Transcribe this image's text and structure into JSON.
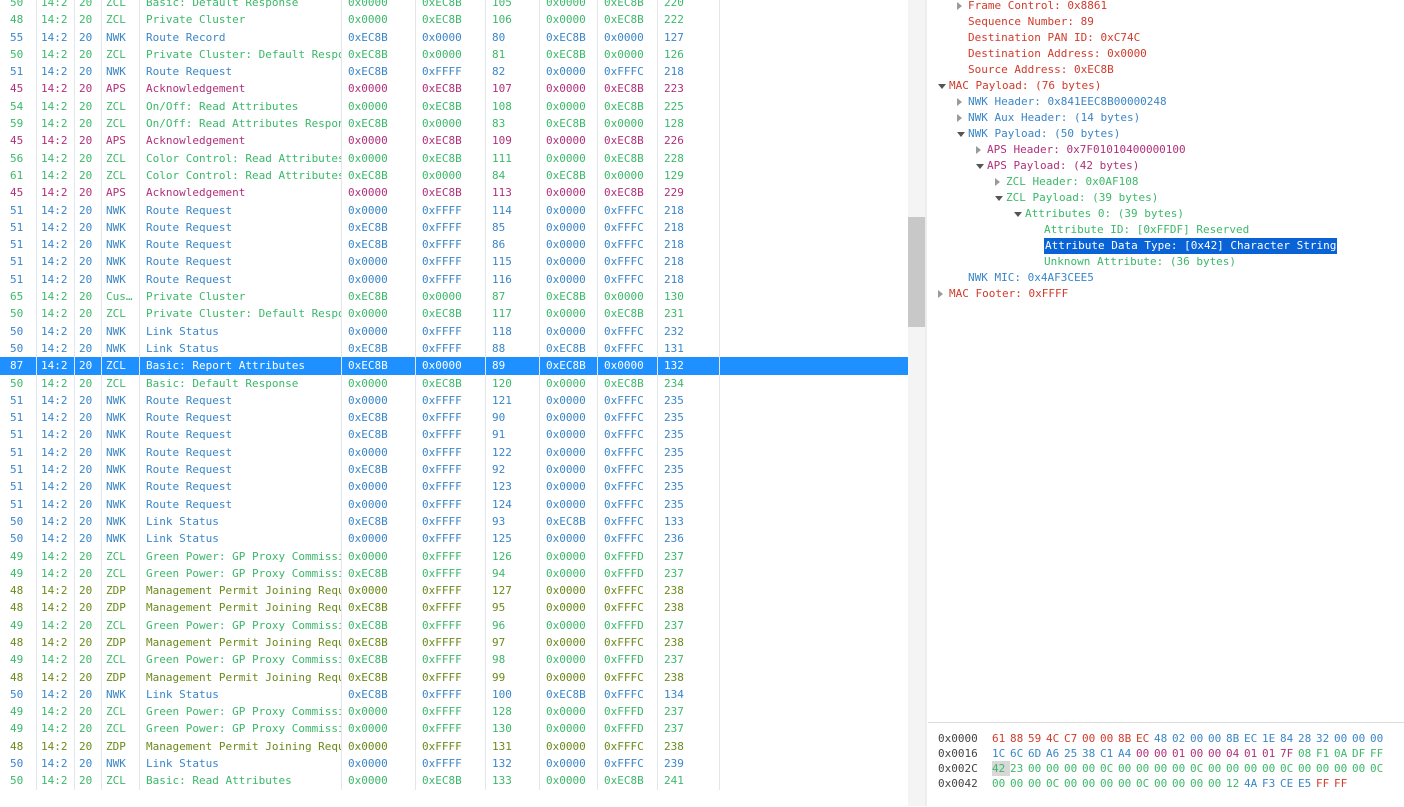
{
  "packet_list": {
    "rows": [
      {
        "len": "50",
        "time": "14:2",
        "ch": "20",
        "type": "ZCL",
        "info": "Basic: Default Response",
        "src": "0x0000",
        "dst": "0xEC8B",
        "seq": "105",
        "s2": "0x0000",
        "d2": "0xEC8B",
        "n": "220"
      },
      {
        "len": "48",
        "time": "14:2",
        "ch": "20",
        "type": "ZCL",
        "info": "Private Cluster",
        "src": "0x0000",
        "dst": "0xEC8B",
        "seq": "106",
        "s2": "0x0000",
        "d2": "0xEC8B",
        "n": "222"
      },
      {
        "len": "55",
        "time": "14:2",
        "ch": "20",
        "type": "NWK",
        "info": "Route Record",
        "src": "0xEC8B",
        "dst": "0x0000",
        "seq": "80",
        "s2": "0xEC8B",
        "d2": "0x0000",
        "n": "127"
      },
      {
        "len": "50",
        "time": "14:2",
        "ch": "20",
        "type": "ZCL",
        "info": "Private Cluster: Default Respo…",
        "src": "0xEC8B",
        "dst": "0x0000",
        "seq": "81",
        "s2": "0xEC8B",
        "d2": "0x0000",
        "n": "126"
      },
      {
        "len": "51",
        "time": "14:2",
        "ch": "20",
        "type": "NWK",
        "info": "Route Request",
        "src": "0xEC8B",
        "dst": "0xFFFF",
        "seq": "82",
        "s2": "0x0000",
        "d2": "0xFFFC",
        "n": "218"
      },
      {
        "len": "45",
        "time": "14:2",
        "ch": "20",
        "type": "APS",
        "info": "Acknowledgement",
        "src": "0x0000",
        "dst": "0xEC8B",
        "seq": "107",
        "s2": "0x0000",
        "d2": "0xEC8B",
        "n": "223"
      },
      {
        "len": "54",
        "time": "14:2",
        "ch": "20",
        "type": "ZCL",
        "info": "On/Off: Read Attributes",
        "src": "0x0000",
        "dst": "0xEC8B",
        "seq": "108",
        "s2": "0x0000",
        "d2": "0xEC8B",
        "n": "225"
      },
      {
        "len": "59",
        "time": "14:2",
        "ch": "20",
        "type": "ZCL",
        "info": "On/Off: Read Attributes Respon…",
        "src": "0xEC8B",
        "dst": "0x0000",
        "seq": "83",
        "s2": "0xEC8B",
        "d2": "0x0000",
        "n": "128"
      },
      {
        "len": "45",
        "time": "14:2",
        "ch": "20",
        "type": "APS",
        "info": "Acknowledgement",
        "src": "0x0000",
        "dst": "0xEC8B",
        "seq": "109",
        "s2": "0x0000",
        "d2": "0xEC8B",
        "n": "226"
      },
      {
        "len": "56",
        "time": "14:2",
        "ch": "20",
        "type": "ZCL",
        "info": "Color Control: Read Attributes",
        "src": "0x0000",
        "dst": "0xEC8B",
        "seq": "111",
        "s2": "0x0000",
        "d2": "0xEC8B",
        "n": "228"
      },
      {
        "len": "61",
        "time": "14:2",
        "ch": "20",
        "type": "ZCL",
        "info": "Color Control: Read Attributes…",
        "src": "0xEC8B",
        "dst": "0x0000",
        "seq": "84",
        "s2": "0xEC8B",
        "d2": "0x0000",
        "n": "129"
      },
      {
        "len": "45",
        "time": "14:2",
        "ch": "20",
        "type": "APS",
        "info": "Acknowledgement",
        "src": "0x0000",
        "dst": "0xEC8B",
        "seq": "113",
        "s2": "0x0000",
        "d2": "0xEC8B",
        "n": "229"
      },
      {
        "len": "51",
        "time": "14:2",
        "ch": "20",
        "type": "NWK",
        "info": "Route Request",
        "src": "0x0000",
        "dst": "0xFFFF",
        "seq": "114",
        "s2": "0x0000",
        "d2": "0xFFFC",
        "n": "218"
      },
      {
        "len": "51",
        "time": "14:2",
        "ch": "20",
        "type": "NWK",
        "info": "Route Request",
        "src": "0xEC8B",
        "dst": "0xFFFF",
        "seq": "85",
        "s2": "0x0000",
        "d2": "0xFFFC",
        "n": "218"
      },
      {
        "len": "51",
        "time": "14:2",
        "ch": "20",
        "type": "NWK",
        "info": "Route Request",
        "src": "0xEC8B",
        "dst": "0xFFFF",
        "seq": "86",
        "s2": "0x0000",
        "d2": "0xFFFC",
        "n": "218"
      },
      {
        "len": "51",
        "time": "14:2",
        "ch": "20",
        "type": "NWK",
        "info": "Route Request",
        "src": "0x0000",
        "dst": "0xFFFF",
        "seq": "115",
        "s2": "0x0000",
        "d2": "0xFFFC",
        "n": "218"
      },
      {
        "len": "51",
        "time": "14:2",
        "ch": "20",
        "type": "NWK",
        "info": "Route Request",
        "src": "0x0000",
        "dst": "0xFFFF",
        "seq": "116",
        "s2": "0x0000",
        "d2": "0xFFFC",
        "n": "218"
      },
      {
        "len": "65",
        "time": "14:2",
        "ch": "20",
        "type": "Cus…",
        "info": "Private Cluster",
        "src": "0xEC8B",
        "dst": "0x0000",
        "seq": "87",
        "s2": "0xEC8B",
        "d2": "0x0000",
        "n": "130"
      },
      {
        "len": "50",
        "time": "14:2",
        "ch": "20",
        "type": "ZCL",
        "info": "Private Cluster: Default Respo…",
        "src": "0x0000",
        "dst": "0xEC8B",
        "seq": "117",
        "s2": "0x0000",
        "d2": "0xEC8B",
        "n": "231"
      },
      {
        "len": "50",
        "time": "14:2",
        "ch": "20",
        "type": "NWK",
        "info": "Link Status",
        "src": "0x0000",
        "dst": "0xFFFF",
        "seq": "118",
        "s2": "0x0000",
        "d2": "0xFFFC",
        "n": "232"
      },
      {
        "len": "50",
        "time": "14:2",
        "ch": "20",
        "type": "NWK",
        "info": "Link Status",
        "src": "0xEC8B",
        "dst": "0xFFFF",
        "seq": "88",
        "s2": "0xEC8B",
        "d2": "0xFFFC",
        "n": "131"
      },
      {
        "len": "87",
        "time": "14:2",
        "ch": "20",
        "type": "ZCL",
        "info": "Basic: Report Attributes",
        "src": "0xEC8B",
        "dst": "0x0000",
        "seq": "89",
        "s2": "0xEC8B",
        "d2": "0x0000",
        "n": "132",
        "selected": true
      },
      {
        "len": "50",
        "time": "14:2",
        "ch": "20",
        "type": "ZCL",
        "info": "Basic: Default Response",
        "src": "0x0000",
        "dst": "0xEC8B",
        "seq": "120",
        "s2": "0x0000",
        "d2": "0xEC8B",
        "n": "234"
      },
      {
        "len": "51",
        "time": "14:2",
        "ch": "20",
        "type": "NWK",
        "info": "Route Request",
        "src": "0x0000",
        "dst": "0xFFFF",
        "seq": "121",
        "s2": "0x0000",
        "d2": "0xFFFC",
        "n": "235"
      },
      {
        "len": "51",
        "time": "14:2",
        "ch": "20",
        "type": "NWK",
        "info": "Route Request",
        "src": "0xEC8B",
        "dst": "0xFFFF",
        "seq": "90",
        "s2": "0x0000",
        "d2": "0xFFFC",
        "n": "235"
      },
      {
        "len": "51",
        "time": "14:2",
        "ch": "20",
        "type": "NWK",
        "info": "Route Request",
        "src": "0xEC8B",
        "dst": "0xFFFF",
        "seq": "91",
        "s2": "0x0000",
        "d2": "0xFFFC",
        "n": "235"
      },
      {
        "len": "51",
        "time": "14:2",
        "ch": "20",
        "type": "NWK",
        "info": "Route Request",
        "src": "0x0000",
        "dst": "0xFFFF",
        "seq": "122",
        "s2": "0x0000",
        "d2": "0xFFFC",
        "n": "235"
      },
      {
        "len": "51",
        "time": "14:2",
        "ch": "20",
        "type": "NWK",
        "info": "Route Request",
        "src": "0xEC8B",
        "dst": "0xFFFF",
        "seq": "92",
        "s2": "0x0000",
        "d2": "0xFFFC",
        "n": "235"
      },
      {
        "len": "51",
        "time": "14:2",
        "ch": "20",
        "type": "NWK",
        "info": "Route Request",
        "src": "0x0000",
        "dst": "0xFFFF",
        "seq": "123",
        "s2": "0x0000",
        "d2": "0xFFFC",
        "n": "235"
      },
      {
        "len": "51",
        "time": "14:2",
        "ch": "20",
        "type": "NWK",
        "info": "Route Request",
        "src": "0x0000",
        "dst": "0xFFFF",
        "seq": "124",
        "s2": "0x0000",
        "d2": "0xFFFC",
        "n": "235"
      },
      {
        "len": "50",
        "time": "14:2",
        "ch": "20",
        "type": "NWK",
        "info": "Link Status",
        "src": "0xEC8B",
        "dst": "0xFFFF",
        "seq": "93",
        "s2": "0xEC8B",
        "d2": "0xFFFC",
        "n": "133"
      },
      {
        "len": "50",
        "time": "14:2",
        "ch": "20",
        "type": "NWK",
        "info": "Link Status",
        "src": "0x0000",
        "dst": "0xFFFF",
        "seq": "125",
        "s2": "0x0000",
        "d2": "0xFFFC",
        "n": "236"
      },
      {
        "len": "49",
        "time": "14:2",
        "ch": "20",
        "type": "ZCL",
        "info": "Green Power: GP Proxy Commissi…",
        "src": "0x0000",
        "dst": "0xFFFF",
        "seq": "126",
        "s2": "0x0000",
        "d2": "0xFFFD",
        "n": "237"
      },
      {
        "len": "49",
        "time": "14:2",
        "ch": "20",
        "type": "ZCL",
        "info": "Green Power: GP Proxy Commissi…",
        "src": "0xEC8B",
        "dst": "0xFFFF",
        "seq": "94",
        "s2": "0x0000",
        "d2": "0xFFFD",
        "n": "237"
      },
      {
        "len": "48",
        "time": "14:2",
        "ch": "20",
        "type": "ZDP",
        "info": "Management Permit Joining Requ…",
        "src": "0x0000",
        "dst": "0xFFFF",
        "seq": "127",
        "s2": "0x0000",
        "d2": "0xFFFC",
        "n": "238"
      },
      {
        "len": "48",
        "time": "14:2",
        "ch": "20",
        "type": "ZDP",
        "info": "Management Permit Joining Requ…",
        "src": "0xEC8B",
        "dst": "0xFFFF",
        "seq": "95",
        "s2": "0x0000",
        "d2": "0xFFFC",
        "n": "238"
      },
      {
        "len": "49",
        "time": "14:2",
        "ch": "20",
        "type": "ZCL",
        "info": "Green Power: GP Proxy Commissi…",
        "src": "0xEC8B",
        "dst": "0xFFFF",
        "seq": "96",
        "s2": "0x0000",
        "d2": "0xFFFD",
        "n": "237"
      },
      {
        "len": "48",
        "time": "14:2",
        "ch": "20",
        "type": "ZDP",
        "info": "Management Permit Joining Requ…",
        "src": "0xEC8B",
        "dst": "0xFFFF",
        "seq": "97",
        "s2": "0x0000",
        "d2": "0xFFFC",
        "n": "238"
      },
      {
        "len": "49",
        "time": "14:2",
        "ch": "20",
        "type": "ZCL",
        "info": "Green Power: GP Proxy Commissi…",
        "src": "0xEC8B",
        "dst": "0xFFFF",
        "seq": "98",
        "s2": "0x0000",
        "d2": "0xFFFD",
        "n": "237"
      },
      {
        "len": "48",
        "time": "14:2",
        "ch": "20",
        "type": "ZDP",
        "info": "Management Permit Joining Requ…",
        "src": "0xEC8B",
        "dst": "0xFFFF",
        "seq": "99",
        "s2": "0x0000",
        "d2": "0xFFFC",
        "n": "238"
      },
      {
        "len": "50",
        "time": "14:2",
        "ch": "20",
        "type": "NWK",
        "info": "Link Status",
        "src": "0xEC8B",
        "dst": "0xFFFF",
        "seq": "100",
        "s2": "0xEC8B",
        "d2": "0xFFFC",
        "n": "134"
      },
      {
        "len": "49",
        "time": "14:2",
        "ch": "20",
        "type": "ZCL",
        "info": "Green Power: GP Proxy Commissi…",
        "src": "0x0000",
        "dst": "0xFFFF",
        "seq": "128",
        "s2": "0x0000",
        "d2": "0xFFFD",
        "n": "237"
      },
      {
        "len": "49",
        "time": "14:2",
        "ch": "20",
        "type": "ZCL",
        "info": "Green Power: GP Proxy Commissi…",
        "src": "0x0000",
        "dst": "0xFFFF",
        "seq": "130",
        "s2": "0x0000",
        "d2": "0xFFFD",
        "n": "237"
      },
      {
        "len": "48",
        "time": "14:2",
        "ch": "20",
        "type": "ZDP",
        "info": "Management Permit Joining Requ…",
        "src": "0x0000",
        "dst": "0xFFFF",
        "seq": "131",
        "s2": "0x0000",
        "d2": "0xFFFC",
        "n": "238"
      },
      {
        "len": "50",
        "time": "14:2",
        "ch": "20",
        "type": "NWK",
        "info": "Link Status",
        "src": "0x0000",
        "dst": "0xFFFF",
        "seq": "132",
        "s2": "0x0000",
        "d2": "0xFFFC",
        "n": "239"
      },
      {
        "len": "50",
        "time": "14:2",
        "ch": "20",
        "type": "ZCL",
        "info": "Basic: Read Attributes",
        "src": "0x0000",
        "dst": "0xEC8B",
        "seq": "133",
        "s2": "0x0000",
        "d2": "0xEC8B",
        "n": "241"
      }
    ]
  },
  "detail_tree": {
    "nodes": [
      {
        "label": "Frame Control: 0x8861",
        "depth": 1,
        "toggle": "closed",
        "color": "mac"
      },
      {
        "label": "Sequence Number: 89",
        "depth": 1,
        "toggle": "none",
        "color": "mac"
      },
      {
        "label": "Destination PAN ID: 0xC74C",
        "depth": 1,
        "toggle": "none",
        "color": "mac"
      },
      {
        "label": "Destination Address: 0x0000",
        "depth": 1,
        "toggle": "none",
        "color": "mac"
      },
      {
        "label": "Source Address: 0xEC8B",
        "depth": 1,
        "toggle": "none",
        "color": "mac"
      },
      {
        "label": "MAC Payload: (76 bytes)",
        "depth": 0,
        "toggle": "open",
        "color": "mac"
      },
      {
        "label": "NWK Header: 0x841EEC8B00000248",
        "depth": 1,
        "toggle": "closed",
        "color": "nwk"
      },
      {
        "label": "NWK Aux Header: (14 bytes)",
        "depth": 1,
        "toggle": "closed",
        "color": "nwk"
      },
      {
        "label": "NWK Payload: (50 bytes)",
        "depth": 1,
        "toggle": "open",
        "color": "nwk"
      },
      {
        "label": "APS Header: 0x7F01010400000100",
        "depth": 2,
        "toggle": "closed",
        "color": "aps"
      },
      {
        "label": "APS Payload: (42 bytes)",
        "depth": 2,
        "toggle": "open",
        "color": "aps"
      },
      {
        "label": "ZCL Header: 0x0AF108",
        "depth": 3,
        "toggle": "closed",
        "color": "zcl"
      },
      {
        "label": "ZCL Payload: (39 bytes)",
        "depth": 3,
        "toggle": "open",
        "color": "zcl"
      },
      {
        "label": "Attributes 0: (39 bytes)",
        "depth": 4,
        "toggle": "open",
        "color": "zcl"
      },
      {
        "label": "Attribute ID: [0xFFDF] Reserved",
        "depth": 5,
        "toggle": "none",
        "color": "zcl"
      },
      {
        "label": "Attribute Data Type: [0x42] Character String",
        "depth": 5,
        "toggle": "none",
        "color": "zcl",
        "highlight": true
      },
      {
        "label": "Unknown Attribute: (36 bytes)",
        "depth": 5,
        "toggle": "none",
        "color": "zcl"
      },
      {
        "label": "NWK MIC: 0x4AF3CEE5",
        "depth": 1,
        "toggle": "none",
        "color": "nwk"
      },
      {
        "label": "MAC Footer: 0xFFFF",
        "depth": 0,
        "toggle": "closed",
        "color": "mac"
      }
    ]
  },
  "hex_pane": {
    "rows": [
      {
        "offset": "0x0000",
        "bytes": [
          "61",
          "88",
          "59",
          "4C",
          "C7",
          "00",
          "00",
          "8B",
          "EC",
          "48",
          "02",
          "00",
          "00",
          "8B",
          "EC",
          "1E",
          "84",
          "28",
          "32",
          "00",
          "00",
          "00"
        ],
        "colors": [
          "mac",
          "mac",
          "mac",
          "mac",
          "mac",
          "mac",
          "mac",
          "mac",
          "mac",
          "nwk",
          "nwk",
          "nwk",
          "nwk",
          "nwk",
          "nwk",
          "nwk",
          "nwk",
          "nwk",
          "nwk",
          "nwk",
          "nwk",
          "nwk"
        ]
      },
      {
        "offset": "0x0016",
        "bytes": [
          "1C",
          "6C",
          "6D",
          "A6",
          "25",
          "38",
          "C1",
          "A4",
          "00",
          "00",
          "01",
          "00",
          "00",
          "04",
          "01",
          "01",
          "7F",
          "08",
          "F1",
          "0A",
          "DF",
          "FF"
        ],
        "colors": [
          "nwk",
          "nwk",
          "nwk",
          "nwk",
          "nwk",
          "nwk",
          "nwk",
          "nwk",
          "aps",
          "aps",
          "aps",
          "aps",
          "aps",
          "aps",
          "aps",
          "aps",
          "aps",
          "zcl",
          "zcl",
          "zcl",
          "zcl",
          "zcl"
        ]
      },
      {
        "offset": "0x002C",
        "bytes": [
          "42",
          "23",
          "00",
          "00",
          "00",
          "00",
          "0C",
          "00",
          "00",
          "00",
          "00",
          "0C",
          "00",
          "00",
          "00",
          "00",
          "0C",
          "00",
          "00",
          "00",
          "00",
          "0C"
        ],
        "colors": [
          "zcl",
          "zcl",
          "zcl",
          "zcl",
          "zcl",
          "zcl",
          "zcl",
          "zcl",
          "zcl",
          "zcl",
          "zcl",
          "zcl",
          "zcl",
          "zcl",
          "zcl",
          "zcl",
          "zcl",
          "zcl",
          "zcl",
          "zcl",
          "zcl",
          "zcl"
        ],
        "selected_index": 0
      },
      {
        "offset": "0x0042",
        "bytes": [
          "00",
          "00",
          "00",
          "0C",
          "00",
          "00",
          "00",
          "00",
          "0C",
          "00",
          "00",
          "00",
          "00",
          "12",
          "4A",
          "F3",
          "CE",
          "E5",
          "FF",
          "FF"
        ],
        "colors": [
          "zcl",
          "zcl",
          "zcl",
          "zcl",
          "zcl",
          "zcl",
          "zcl",
          "zcl",
          "zcl",
          "zcl",
          "zcl",
          "zcl",
          "zcl",
          "zcl",
          "nwk",
          "nwk",
          "nwk",
          "nwk",
          "mac",
          "mac"
        ]
      }
    ]
  },
  "colors": {
    "selection": "#1e90ff",
    "zcl": "#3bb86a",
    "nwk": "#3a86c8",
    "aps": "#b0307a",
    "zdp": "#6a8a1a",
    "mac": "#d13b2b"
  }
}
